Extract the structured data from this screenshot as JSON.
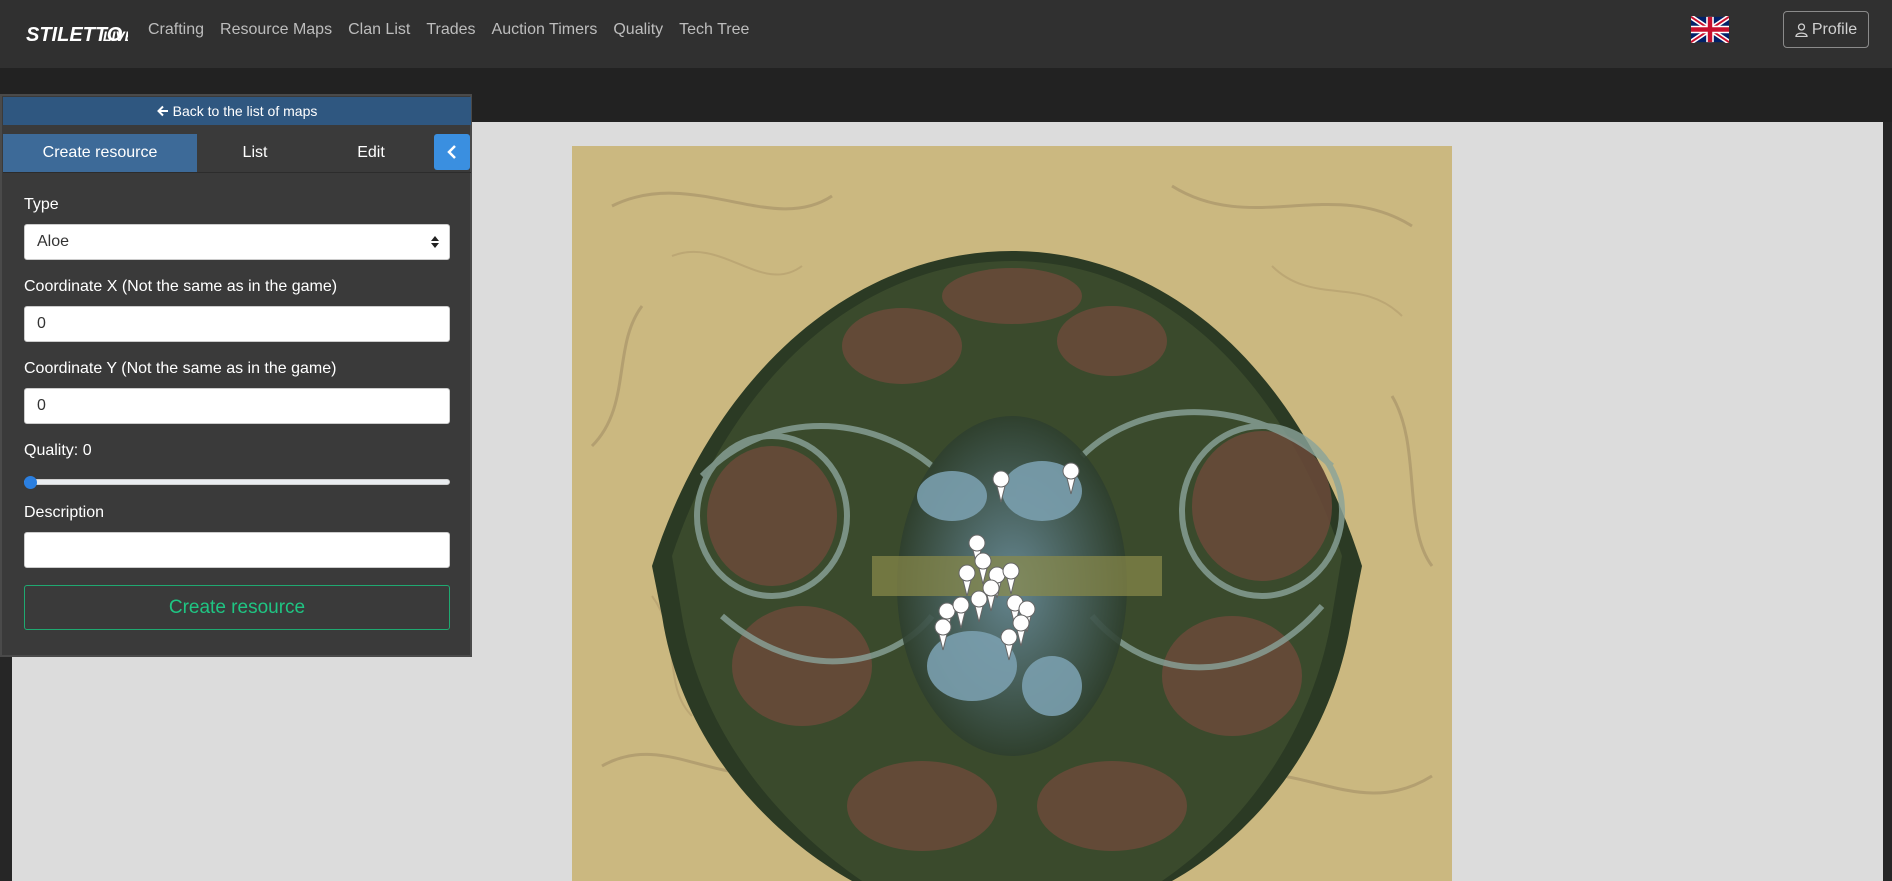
{
  "brand": {
    "logo_text": "STILETTO.LIVE"
  },
  "nav": {
    "items": [
      {
        "label": "Crafting"
      },
      {
        "label": "Resource Maps"
      },
      {
        "label": "Clan List"
      },
      {
        "label": "Trades"
      },
      {
        "label": "Auction Timers"
      },
      {
        "label": "Quality"
      },
      {
        "label": "Tech Tree"
      }
    ],
    "language_flag": "uk-flag-icon",
    "profile_label": "Profile"
  },
  "panel": {
    "back_label": "Back to the list of maps",
    "tabs": [
      {
        "label": "Create resource",
        "active": true
      },
      {
        "label": "List",
        "active": false
      },
      {
        "label": "Edit",
        "active": false
      }
    ],
    "type": {
      "label": "Type",
      "value": "Aloe"
    },
    "coord_x": {
      "label": "Coordinate X (Not the same as in the game)",
      "value": "0"
    },
    "coord_y": {
      "label": "Coordinate Y (Not the same as in the game)",
      "value": "0"
    },
    "quality": {
      "label": "Quality: 0",
      "value": 0
    },
    "description": {
      "label": "Description",
      "value": ""
    },
    "submit_label": "Create resource"
  },
  "colors": {
    "navbar": "#303030",
    "accent_blue": "#3d6a98",
    "button_blue": "#3a8fe0",
    "success_green": "#1fc583"
  }
}
